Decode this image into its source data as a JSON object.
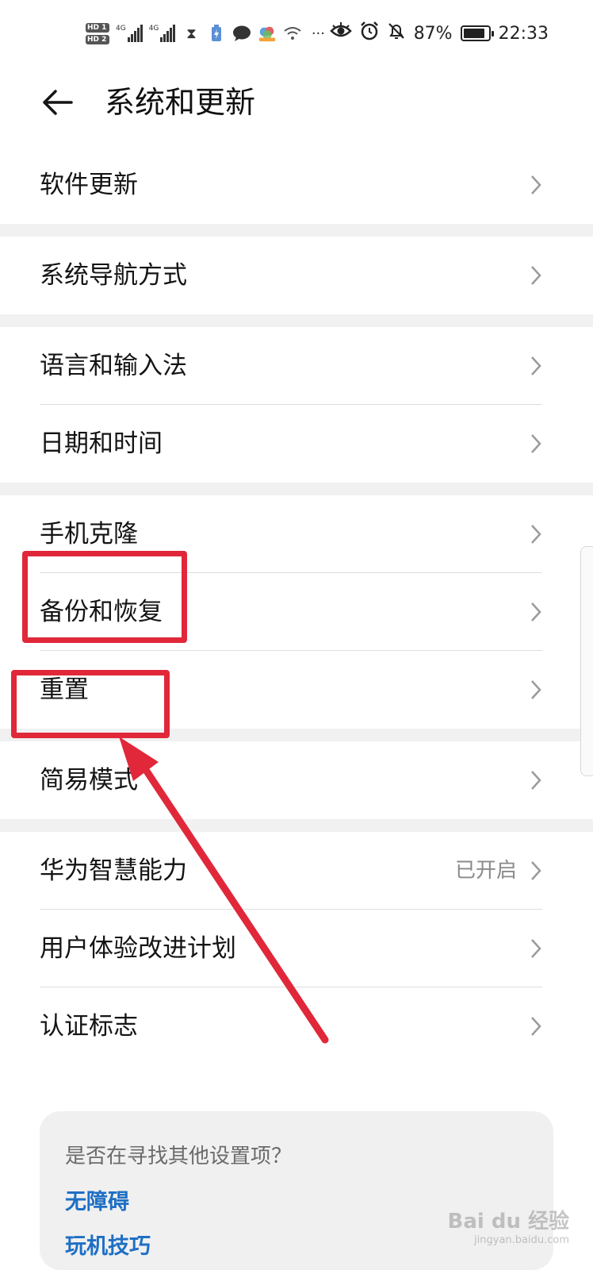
{
  "status_bar": {
    "hd1": "HD 1",
    "hd2": "HD 2",
    "sig1_label": "4G",
    "sig2_label": "4G",
    "battery_text": "87%",
    "battery_level": 0.87,
    "time": "22:33"
  },
  "header": {
    "title": "系统和更新"
  },
  "groups": [
    {
      "items": [
        {
          "label": "软件更新"
        }
      ]
    },
    {
      "items": [
        {
          "label": "系统导航方式"
        }
      ]
    },
    {
      "items": [
        {
          "label": "语言和输入法"
        },
        {
          "label": "日期和时间"
        }
      ]
    },
    {
      "items": [
        {
          "label": "手机克隆"
        },
        {
          "label": "备份和恢复"
        },
        {
          "label": "重置"
        }
      ]
    },
    {
      "items": [
        {
          "label": "简易模式"
        }
      ]
    },
    {
      "items": [
        {
          "label": "华为智慧能力",
          "value": "已开启"
        },
        {
          "label": "用户体验改进计划"
        },
        {
          "label": "认证标志"
        }
      ]
    }
  ],
  "suggest": {
    "question": "是否在寻找其他设置项？",
    "links": [
      "无障碍",
      "玩机技巧"
    ]
  },
  "watermark": {
    "brand": "Bai du 经验",
    "sub": "jingyan.baidu.com"
  },
  "colors": {
    "annotation": "#e0283a",
    "link": "#1e6fc4",
    "background": "#f1f1f1"
  }
}
